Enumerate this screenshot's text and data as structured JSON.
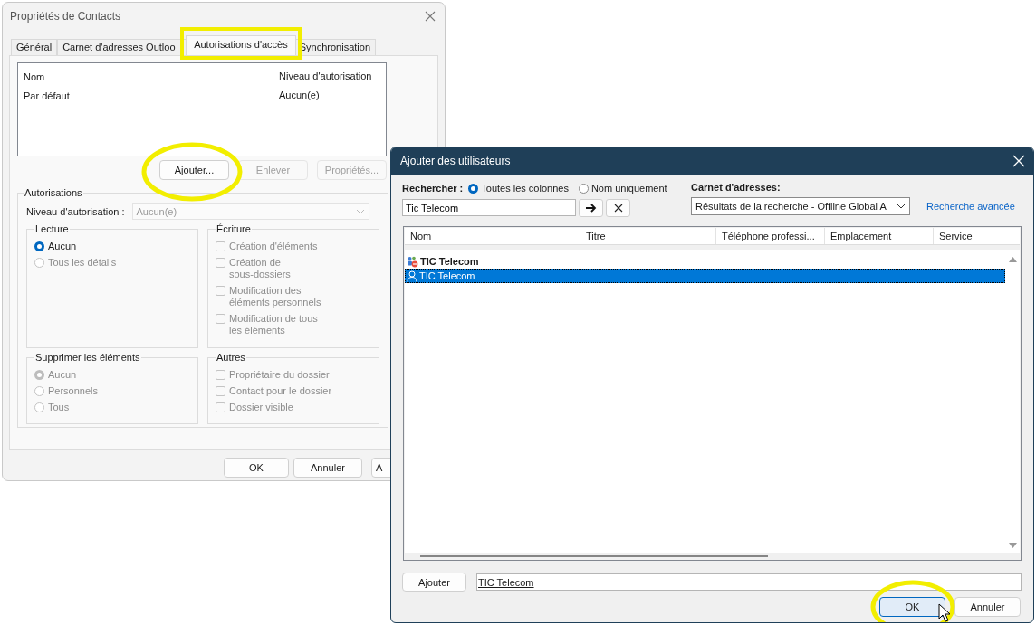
{
  "properties_dialog": {
    "title": "Propriétés de Contacts",
    "tabs": [
      {
        "label": "Général",
        "selected": false,
        "highlighted": false
      },
      {
        "label": "Carnet d'adresses Outloo",
        "selected": false,
        "highlighted": false
      },
      {
        "label": "Autorisations d'accès",
        "selected": true,
        "highlighted": true
      },
      {
        "label": "Synchronisation",
        "selected": false,
        "highlighted": false
      }
    ],
    "permissions_list": {
      "columns": [
        "Nom",
        "Niveau d'autorisation"
      ],
      "rows": [
        {
          "name": "Par défaut",
          "level": "Aucun(e)"
        }
      ]
    },
    "list_buttons": [
      {
        "label": "Ajouter...",
        "disabled": false,
        "highlighted": true
      },
      {
        "label": "Enlever",
        "disabled": true,
        "highlighted": false
      },
      {
        "label": "Propriétés...",
        "disabled": true,
        "highlighted": false
      }
    ],
    "permissions_group": {
      "title": "Autorisations",
      "level_label": "Niveau d'autorisation :",
      "level_value": "Aucun(e)",
      "disabled": true,
      "groups": [
        {
          "title": "Lecture",
          "items": [
            {
              "kind": "radio",
              "label": "Aucun",
              "selected": true,
              "disabled": false
            },
            {
              "kind": "radio",
              "label": "Tous les détails",
              "selected": false,
              "disabled": true
            }
          ]
        },
        {
          "title": "Écriture",
          "items": [
            {
              "kind": "checkbox",
              "label": "Création d'éléments",
              "checked": false,
              "disabled": true
            },
            {
              "kind": "checkbox",
              "label": "Création de\nsous-dossiers",
              "checked": false,
              "disabled": true
            },
            {
              "kind": "checkbox",
              "label": "Modification des\néléments personnels",
              "checked": false,
              "disabled": true
            },
            {
              "kind": "checkbox",
              "label": "Modification de tous\nles éléments",
              "checked": false,
              "disabled": true
            }
          ]
        },
        {
          "title": "Supprimer les éléments",
          "items": [
            {
              "kind": "radio",
              "label": "Aucun",
              "selected": true,
              "disabled": true
            },
            {
              "kind": "radio",
              "label": "Personnels",
              "selected": false,
              "disabled": true
            },
            {
              "kind": "radio",
              "label": "Tous",
              "selected": false,
              "disabled": true
            }
          ]
        },
        {
          "title": "Autres",
          "items": [
            {
              "kind": "checkbox",
              "label": "Propriétaire du dossier",
              "checked": false,
              "disabled": true
            },
            {
              "kind": "checkbox",
              "label": "Contact pour le dossier",
              "checked": false,
              "disabled": true
            },
            {
              "kind": "checkbox",
              "label": "Dossier visible",
              "checked": false,
              "disabled": true
            }
          ]
        }
      ]
    },
    "buttons": [
      {
        "label": "OK"
      },
      {
        "label": "Annuler"
      },
      {
        "label": "A"
      }
    ]
  },
  "add_users_dialog": {
    "title": "Ajouter des utilisateurs",
    "search_label": "Rechercher :",
    "search_scope": [
      {
        "label": "Toutes les colonnes",
        "selected": true
      },
      {
        "label": "Nom uniquement",
        "selected": false
      }
    ],
    "search_value": "Tic Telecom",
    "address_book_label": "Carnet d'adresses:",
    "address_book_value": "Résultats de la recherche - Offline Global A",
    "advanced_search_link": "Recherche avancée",
    "columns": [
      "Nom",
      "Titre",
      "Téléphone professi...",
      "Emplacement",
      "Service"
    ],
    "rows": [
      {
        "kind": "group",
        "name": "TIC Telecom",
        "selected": false
      },
      {
        "kind": "user",
        "name": "TIC Telecom",
        "selected": true
      }
    ],
    "add_button": "Ajouter",
    "recipients_value": "TIC Telecom",
    "buttons": [
      {
        "label": "OK",
        "highlighted": true
      },
      {
        "label": "Annuler",
        "highlighted": false
      }
    ]
  }
}
